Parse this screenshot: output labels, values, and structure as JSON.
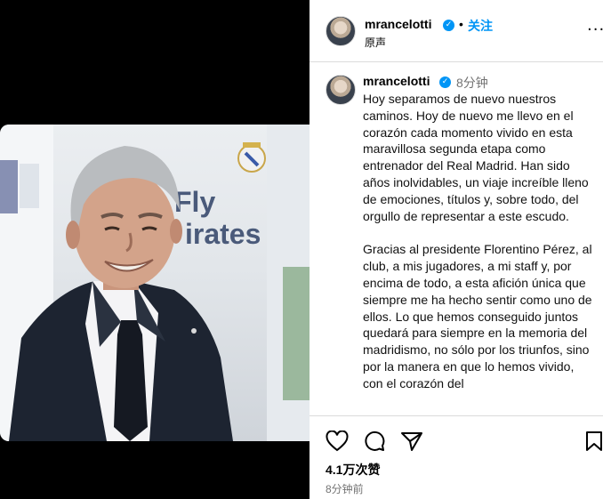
{
  "header": {
    "username": "mrancelotti",
    "separator": "•",
    "follow_label": "关注",
    "audio_label": "原声",
    "more_label": "..."
  },
  "caption": {
    "username": "mrancelotti",
    "time": "8分钟",
    "paragraphs": [
      "Hoy separamos de nuevo nuestros caminos. Hoy de nuevo me llevo en el corazón cada momento vivido en esta maravillosa segunda etapa como entrenador del Real Madrid. Han sido años inolvidables, un viaje increíble lleno de emociones, títulos y, sobre todo, del orgullo de representar a este escudo.",
      "Gracias al presidente Florentino Pérez, al club, a mis jugadores, a mi staff y, por encima de todo, a esta afición única que siempre me ha hecho sentir como uno de ellos. Lo que hemos conseguido juntos quedará para siempre en la memoria del madridismo, no sólo por los triunfos, sino por la manera en que lo hemos vivido, con el corazón del"
    ]
  },
  "media": {
    "shirt_text_1": "Fly",
    "shirt_text_2": "irates"
  },
  "actions": {
    "icons": [
      "heart-icon",
      "comment-icon",
      "share-icon",
      "bookmark-icon"
    ]
  },
  "stats": {
    "likes": "4.1万次赞",
    "posted": "8分钟前"
  },
  "colors": {
    "accent": "#0095f6",
    "muted": "#737373",
    "divider": "#dbdbdb"
  }
}
